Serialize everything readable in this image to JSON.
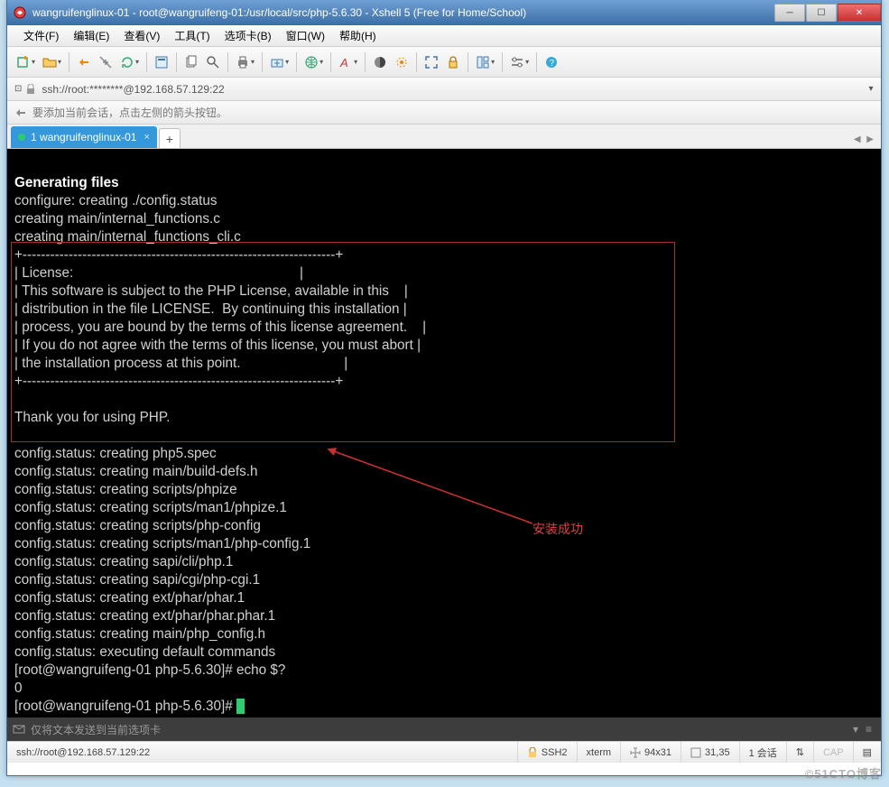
{
  "titlebar": {
    "title": "wangruifenglinux-01 - root@wangruifeng-01:/usr/local/src/php-5.6.30 - Xshell 5 (Free for Home/School)"
  },
  "menu": {
    "file": "文件(F)",
    "edit": "编辑(E)",
    "view": "查看(V)",
    "tools": "工具(T)",
    "tabs": "选项卡(B)",
    "window": "窗口(W)",
    "help": "帮助(H)"
  },
  "addressbar": {
    "text": "ssh://root:********@192.168.57.129:22"
  },
  "hint": {
    "text": "要添加当前会话，点击左侧的箭头按钮。"
  },
  "tab": {
    "index": "1",
    "label": "wangruifenglinux-01"
  },
  "terminal": {
    "lines": [
      {
        "t": "",
        "b": false
      },
      {
        "t": "Generating files",
        "b": true
      },
      {
        "t": "configure: creating ./config.status",
        "b": false
      },
      {
        "t": "creating main/internal_functions.c",
        "b": false
      },
      {
        "t": "creating main/internal_functions_cli.c",
        "b": false
      },
      {
        "t": "+--------------------------------------------------------------------+",
        "b": false
      },
      {
        "t": "| License:                                                           |",
        "b": false
      },
      {
        "t": "| This software is subject to the PHP License, available in this    |",
        "b": false
      },
      {
        "t": "| distribution in the file LICENSE.  By continuing this installation |",
        "b": false
      },
      {
        "t": "| process, you are bound by the terms of this license agreement.    |",
        "b": false
      },
      {
        "t": "| If you do not agree with the terms of this license, you must abort |",
        "b": false
      },
      {
        "t": "| the installation process at this point.                           |",
        "b": false
      },
      {
        "t": "+--------------------------------------------------------------------+",
        "b": false
      },
      {
        "t": "",
        "b": false
      },
      {
        "t": "Thank you for using PHP.",
        "b": false
      },
      {
        "t": "",
        "b": false
      },
      {
        "t": "config.status: creating php5.spec",
        "b": false
      },
      {
        "t": "config.status: creating main/build-defs.h",
        "b": false
      },
      {
        "t": "config.status: creating scripts/phpize",
        "b": false
      },
      {
        "t": "config.status: creating scripts/man1/phpize.1",
        "b": false
      },
      {
        "t": "config.status: creating scripts/php-config",
        "b": false
      },
      {
        "t": "config.status: creating scripts/man1/php-config.1",
        "b": false
      },
      {
        "t": "config.status: creating sapi/cli/php.1",
        "b": false
      },
      {
        "t": "config.status: creating sapi/cgi/php-cgi.1",
        "b": false
      },
      {
        "t": "config.status: creating ext/phar/phar.1",
        "b": false
      },
      {
        "t": "config.status: creating ext/phar/phar.phar.1",
        "b": false
      },
      {
        "t": "config.status: creating main/php_config.h",
        "b": false
      },
      {
        "t": "config.status: executing default commands",
        "b": false
      },
      {
        "t": "[root@wangruifeng-01 php-5.6.30]# echo $?",
        "b": false
      },
      {
        "t": "0",
        "b": false
      }
    ],
    "prompt_last": "[root@wangruifeng-01 php-5.6.30]# ",
    "annotation": "安装成功"
  },
  "sendbar": {
    "text": "仅将文本发送到当前选项卡"
  },
  "statusbar": {
    "conn": "ssh://root@192.168.57.129:22",
    "proto": "SSH2",
    "term": "xterm",
    "size": "94x31",
    "pos": "31,35",
    "sessions": "1 会话",
    "cap": "CAP"
  },
  "watermark": "©51CTO博客"
}
